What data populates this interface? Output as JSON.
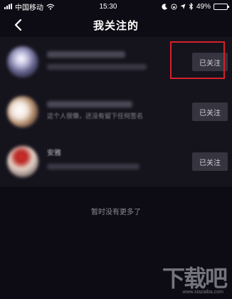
{
  "status_bar": {
    "carrier": "中国移动",
    "time": "15:30",
    "battery": "49%",
    "battery_level": 0.49
  },
  "nav": {
    "title": "我关注的"
  },
  "follow_list": [
    {
      "follow_label": "已关注"
    },
    {
      "follow_label": "已关注",
      "desc": "这个人很懒，还没有留下任何签名"
    },
    {
      "follow_label": "已关注",
      "name": "安雅"
    }
  ],
  "footer": {
    "end_text": "暂时没有更多了"
  },
  "watermark": {
    "main": "下载吧",
    "sub": "www.xiazaiba.com"
  },
  "colors": {
    "background": "#0d0c14",
    "list_background": "#15141d",
    "button_background": "#35343f",
    "highlight": "#d4202a"
  }
}
